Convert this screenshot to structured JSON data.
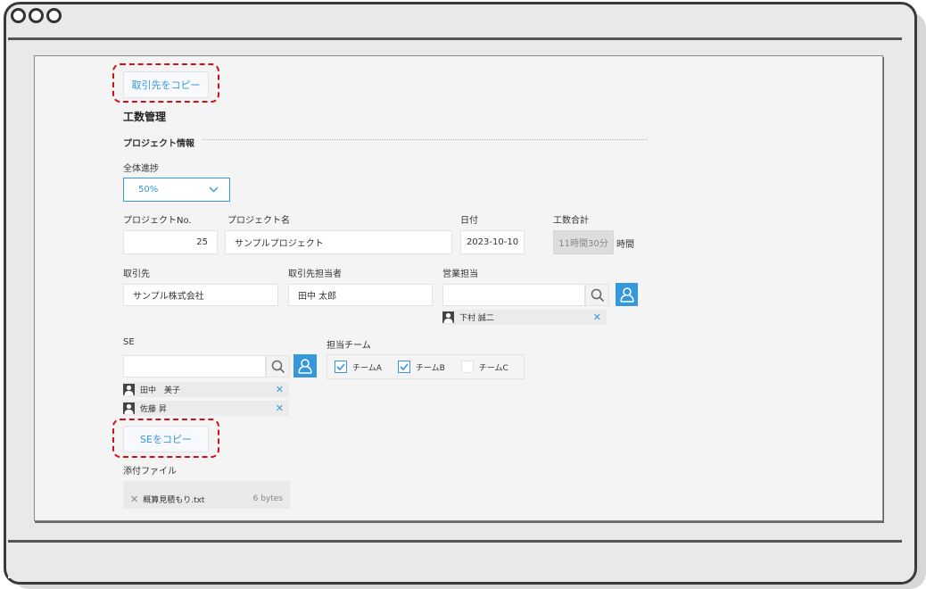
{
  "copy_client_button": "取引先をコピー",
  "page_title": "工数管理",
  "section_project": "プロジェクト情報",
  "progress": {
    "label": "全体進捗",
    "value": "50%"
  },
  "project_no": {
    "label": "プロジェクトNo.",
    "value": "25"
  },
  "project_name": {
    "label": "プロジェクト名",
    "value": "サンプルプロジェクト"
  },
  "date": {
    "label": "日付",
    "value": "2023-10-10"
  },
  "total_hours": {
    "label": "工数合計",
    "value": "11時間30分",
    "unit": "時間"
  },
  "client": {
    "label": "取引先",
    "value": "サンプル株式会社"
  },
  "client_contact": {
    "label": "取引先担当者",
    "value": "田中 太郎"
  },
  "sales": {
    "label": "営業担当",
    "value": "",
    "users": [
      {
        "name": "下村 誠二"
      }
    ]
  },
  "se": {
    "label": "SE",
    "value": "",
    "users": [
      {
        "name": "田中　美子"
      },
      {
        "name": "佐藤 昇"
      }
    ]
  },
  "team": {
    "label": "担当チーム",
    "options": [
      {
        "label": "チームA",
        "checked": true
      },
      {
        "label": "チームB",
        "checked": true
      },
      {
        "label": "チームC",
        "checked": false
      }
    ]
  },
  "copy_se_button": "SEをコピー",
  "attachment": {
    "label": "添付ファイル",
    "file_name": "概算見積もり.txt",
    "file_size": "6 bytes"
  },
  "colors": {
    "accent": "#3498db",
    "highlight": "#d0101a"
  }
}
